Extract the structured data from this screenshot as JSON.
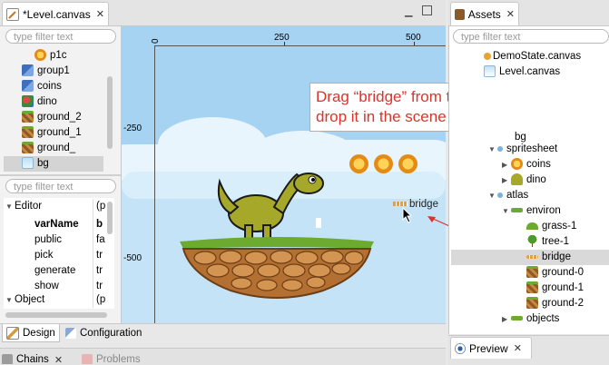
{
  "editor_tab": {
    "title": "*Level.canvas"
  },
  "outline": {
    "filter_placeholder": "type filter text",
    "items": [
      {
        "label": "p1c"
      },
      {
        "label": "group1"
      },
      {
        "label": "coins"
      },
      {
        "label": "dino"
      },
      {
        "label": "ground_2"
      },
      {
        "label": "ground_1"
      },
      {
        "label": "ground_"
      },
      {
        "label": "bg"
      }
    ]
  },
  "properties": {
    "filter_placeholder": "type filter text",
    "rows": [
      {
        "name": "Editor",
        "value": "(p"
      },
      {
        "name": "varName",
        "value": "b"
      },
      {
        "name": "public",
        "value": "fa"
      },
      {
        "name": "pick",
        "value": "tr"
      },
      {
        "name": "generate",
        "value": "tr"
      },
      {
        "name": "show",
        "value": "tr"
      },
      {
        "name": "Object",
        "value": "(p"
      }
    ]
  },
  "bottom_tabs": {
    "design": "Design",
    "configuration": "Configuration"
  },
  "lower_tabs": {
    "chains": "Chains",
    "problems": "Problems"
  },
  "scene": {
    "ruler_x": [
      "0",
      "250",
      "500"
    ],
    "ruler_y": [
      "-250",
      "-500"
    ],
    "bridge_label": "bridge",
    "callout": "Drag “bridge” from the Assets and drop it in the scene"
  },
  "assets": {
    "tab_title": "Assets",
    "filter_placeholder": "type filter text",
    "items": [
      {
        "label": "DemoState.canvas"
      },
      {
        "label": "Level.canvas"
      },
      {
        "label": "bg"
      },
      {
        "label": "spritesheet"
      },
      {
        "label": "coins"
      },
      {
        "label": "dino"
      },
      {
        "label": "atlas"
      },
      {
        "label": "environ"
      },
      {
        "label": "grass-1"
      },
      {
        "label": "tree-1"
      },
      {
        "label": "bridge"
      },
      {
        "label": "ground-0"
      },
      {
        "label": "ground-1"
      },
      {
        "label": "ground-2"
      },
      {
        "label": "objects"
      }
    ]
  },
  "preview": {
    "tab_title": "Preview"
  },
  "colors": {
    "callout_text": "#e0312b",
    "sky": "#a7d3f2",
    "selection": "#d9d9d9"
  }
}
